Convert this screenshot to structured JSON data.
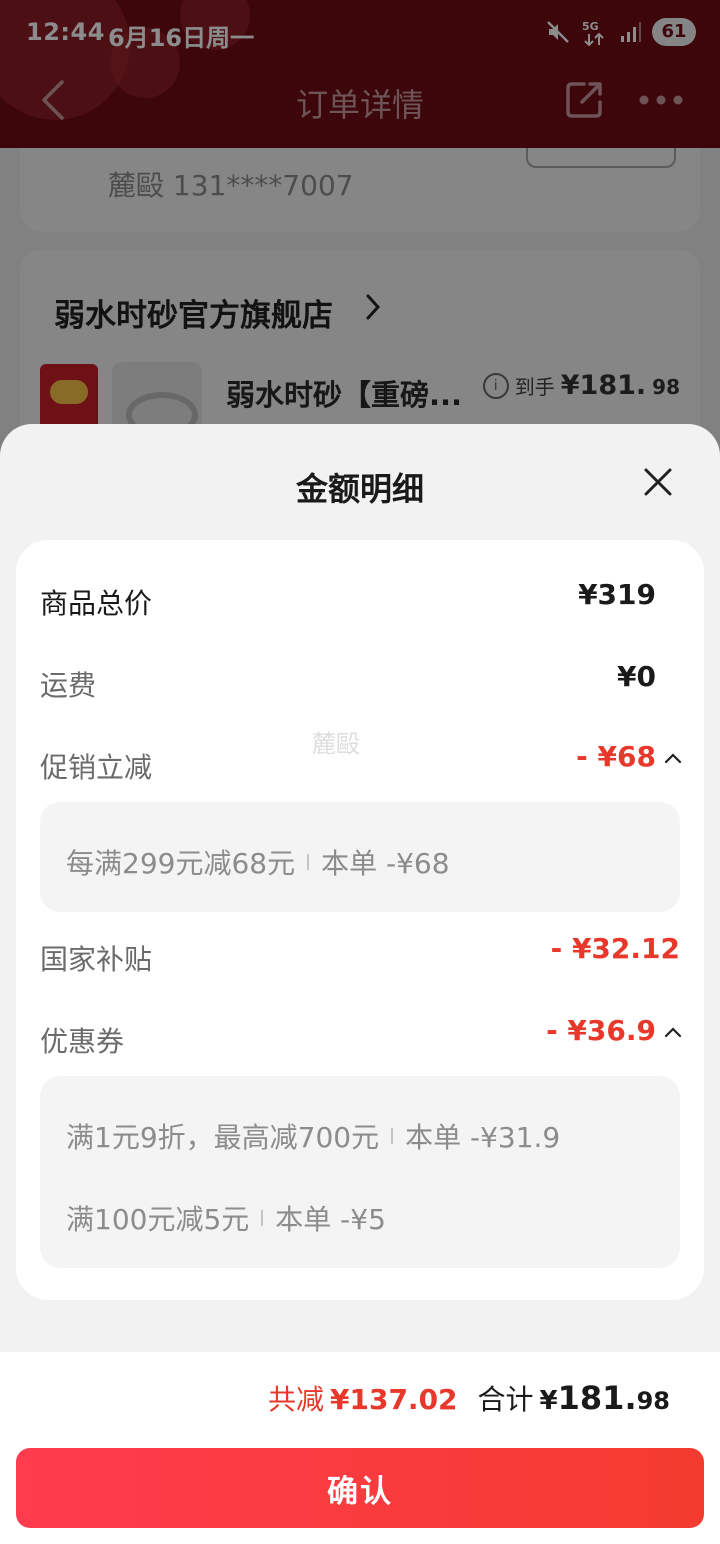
{
  "status_bar": {
    "time": "12:44",
    "date": "6月16日周一",
    "network": "5G",
    "battery": "61"
  },
  "nav": {
    "title": "订单详情"
  },
  "background": {
    "contact": "麓毆 131****7007",
    "shop_name": "弱水时砂官方旗舰店",
    "product_title": "弱水时砂【重磅...",
    "price_label": "到手",
    "price_int": "¥181.",
    "price_dec": "98"
  },
  "sheet": {
    "title": "金额明细",
    "watermark": "麓毆",
    "rows": {
      "goods_total": {
        "label": "商品总价",
        "value": "¥319"
      },
      "shipping": {
        "label": "运费",
        "value": "¥0"
      },
      "promo": {
        "label": "促销立减",
        "value": "- ¥68"
      },
      "subsidy": {
        "label": "国家补贴",
        "value": "- ¥32.12"
      },
      "coupon": {
        "label": "优惠券",
        "value": "- ¥36.9"
      }
    },
    "promo_details": [
      {
        "rule": "每满299元减68元",
        "amount": "本单 -¥68"
      }
    ],
    "coupon_details": [
      {
        "rule": "满1元9折，最高减700元",
        "amount": "本单 -¥31.9"
      },
      {
        "rule": "满100元减5元",
        "amount": "本单 -¥5"
      }
    ]
  },
  "summary": {
    "saved_label": "共减",
    "saved_value": "¥137.02",
    "total_label": "合计",
    "total_yen": "¥",
    "total_int": "181.",
    "total_dec": "98"
  },
  "confirm_label": "确认",
  "colors": {
    "accent_red": "#e8382b",
    "header_bg": "#6d0c14",
    "confirm_start": "#ff3b4e",
    "confirm_end": "#f43b2f"
  }
}
